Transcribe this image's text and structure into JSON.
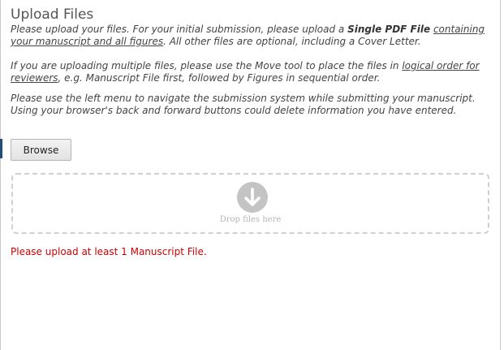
{
  "page_title": "Upload Files",
  "instructions": {
    "p1": {
      "line1_prefix": "Please upload your files. For your initial submission, please upload a ",
      "line1_bold": "Single PDF File",
      "line1_link": "containing",
      "line2_link": "your manuscript and all figures",
      "line2_suffix": ". All other files are optional, including a Cover Letter."
    },
    "p2": {
      "line1_prefix": "If you are uploading multiple files, please use the Move tool to place the files in ",
      "line1_link": "logical order for",
      "line2_link": "reviewers",
      "line2_suffix": ", e.g. Manuscript File first, followed by Figures in sequential order."
    },
    "p3": {
      "line1": "Please use the left menu to navigate the submission system while submitting your manuscript.",
      "line2": "Using your browser's back and forward buttons could delete information you have entered."
    }
  },
  "browse_label": "Browse",
  "drop_zone": {
    "icon": "arrow-down-circle-icon",
    "label": "Drop files here"
  },
  "error_message": "Please upload at least 1 Manuscript File.",
  "colors": {
    "error": "#cc0000",
    "nav_marker": "#1f4e79",
    "drop_border": "#d0d0d0",
    "drop_icon": "#c4c4c4"
  }
}
